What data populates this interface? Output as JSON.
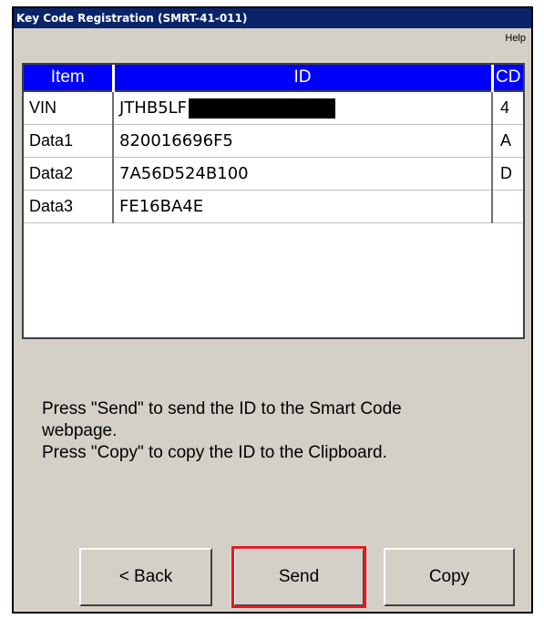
{
  "window": {
    "title": "Key Code Registration (SMRT-41-011)"
  },
  "menu": {
    "help": "Help"
  },
  "table": {
    "headers": {
      "item": "Item",
      "id": "ID",
      "cd": "CD"
    },
    "rows": [
      {
        "item": "VIN",
        "id": "JTHB5LF",
        "cd": "4",
        "redacted": true
      },
      {
        "item": "Data1",
        "id": "820016696F5",
        "cd": "A"
      },
      {
        "item": "Data2",
        "id": "7A56D524B100",
        "cd": "D"
      },
      {
        "item": "Data3",
        "id": "FE16BA4E",
        "cd": ""
      }
    ]
  },
  "instructions": {
    "line1": "Press \"Send\" to send the ID to the Smart Code\nwebpage.",
    "line2": "Press \"Copy\" to copy the ID to the Clipboard."
  },
  "buttons": {
    "back": "< Back",
    "send": "Send",
    "copy": "Copy"
  },
  "colors": {
    "header_bg": "#0000ff",
    "highlight": "#e8191f",
    "window_bg": "#d4d0c8",
    "titlebar": "#0a246a"
  }
}
